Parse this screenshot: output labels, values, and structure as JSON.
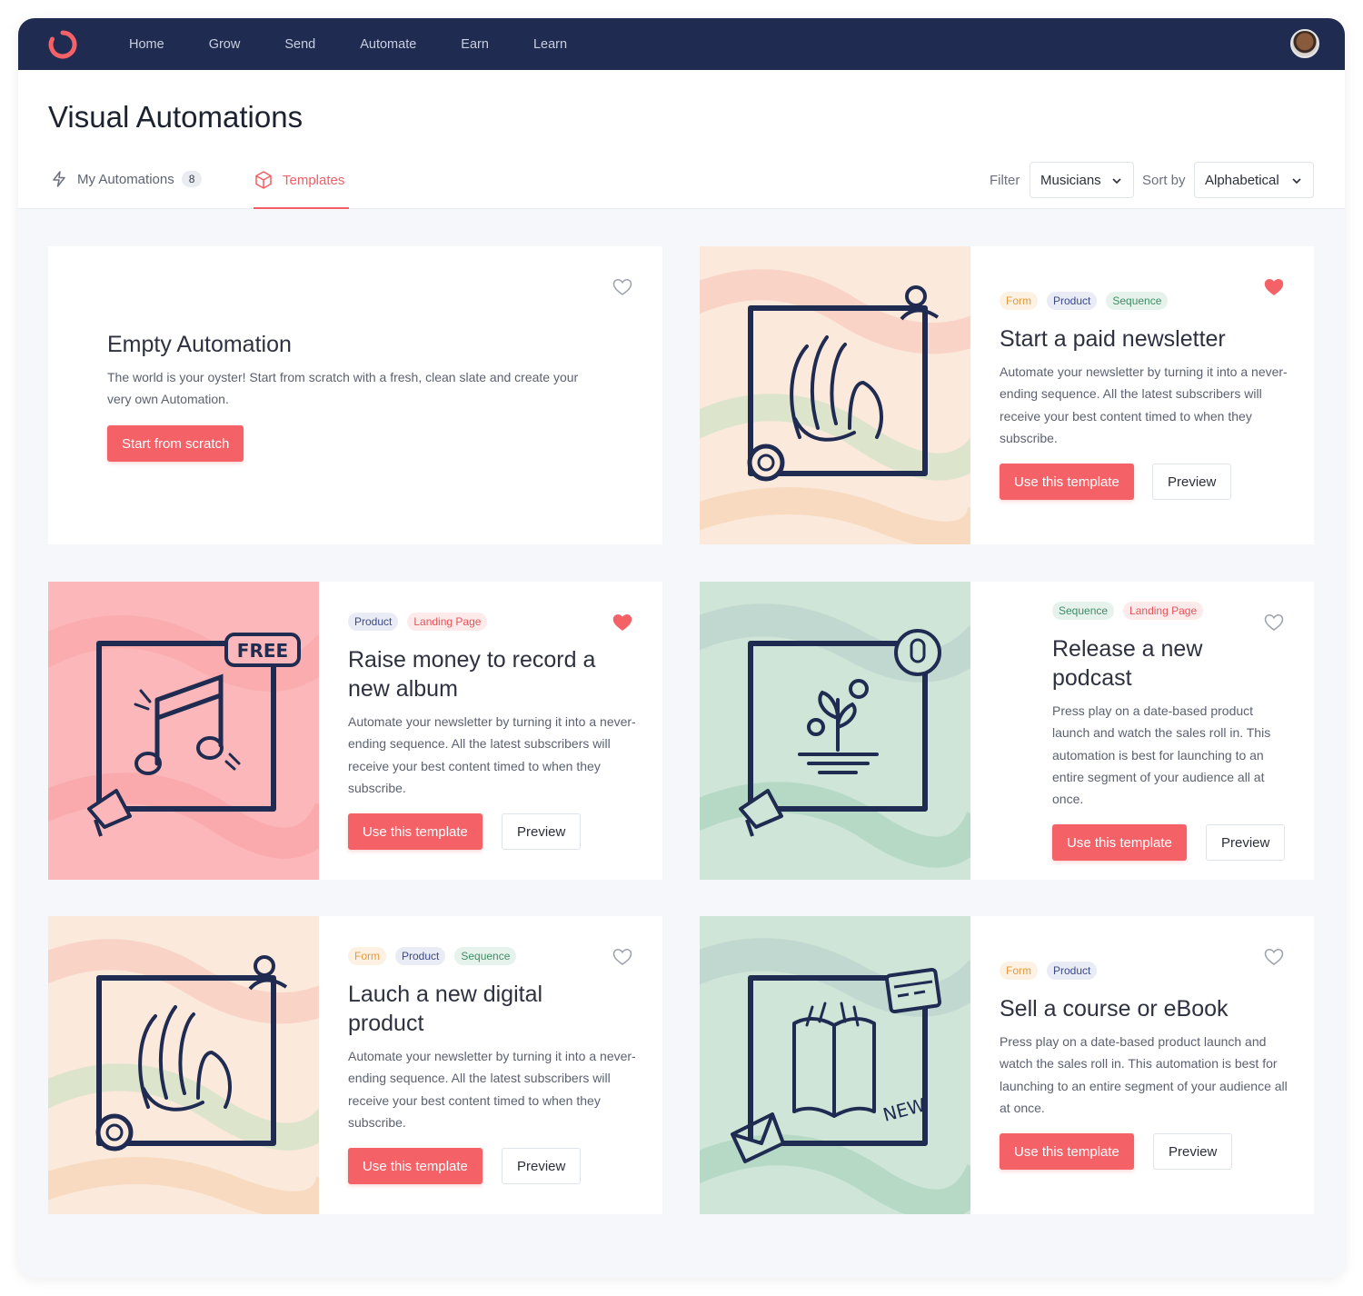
{
  "nav": {
    "items": [
      "Home",
      "Grow",
      "Send",
      "Automate",
      "Earn",
      "Learn"
    ]
  },
  "page": {
    "title": "Visual Automations"
  },
  "tabs": {
    "my_automations": {
      "label": "My Automations",
      "count": "8"
    },
    "templates": {
      "label": "Templates"
    }
  },
  "toolbar": {
    "filter_label": "Filter",
    "filter_value": "Musicians",
    "sort_label": "Sort by",
    "sort_value": "Alphabetical"
  },
  "colors": {
    "nav_bg": "#1f2b50",
    "accent": "#f46268",
    "peach_bg": "#fbe9db",
    "pink_bg": "#fbb7b9",
    "mint_bg": "#cfe5d8"
  },
  "empty_card": {
    "title": "Empty Automation",
    "description": "The world is your oyster! Start from scratch with a fresh, clean slate and create your very own Automation.",
    "button": "Start from scratch",
    "favorite": false
  },
  "templates": [
    {
      "tags": [
        "Form",
        "Product",
        "Sequence"
      ],
      "title": "Start a paid newsletter",
      "description": "Automate your newsletter by turning it into a never-ending sequence. All the latest subscribers will receive your best content timed to when they subscribe.",
      "primary": "Use this template",
      "secondary": "Preview",
      "favorite": true,
      "illustration": "hand-icon"
    },
    {
      "tags": [
        "Product",
        "Landing Page"
      ],
      "title": "Raise money to record a new album",
      "description": "Automate your newsletter by turning it into a never-ending sequence. All the latest subscribers will receive your best content timed to when they subscribe.",
      "primary": "Use this template",
      "secondary": "Preview",
      "favorite": true,
      "illustration": "music-note-icon",
      "badge": "FREE"
    },
    {
      "tags": [
        "Sequence",
        "Landing Page"
      ],
      "title": "Release a new podcast",
      "description": "Press play on a date-based product launch and watch the sales roll in. This automation is best for launching to an entire segment of your audience all at once.",
      "primary": "Use this template",
      "secondary": "Preview",
      "favorite": false,
      "illustration": "plant-icon"
    },
    {
      "tags": [
        "Form",
        "Product",
        "Sequence"
      ],
      "title": "Lauch a new digital product",
      "description": "Automate your newsletter by turning it into a never-ending sequence. All the latest subscribers will receive your best content timed to when they subscribe.",
      "primary": "Use this template",
      "secondary": "Preview",
      "favorite": false,
      "illustration": "hand-icon"
    },
    {
      "tags": [
        "Form",
        "Product"
      ],
      "title": "Sell a course or eBook",
      "description": "Press play on a date-based product launch and watch the sales roll in. This automation is best for launching to an entire segment of your audience all at once.",
      "primary": "Use this template",
      "secondary": "Preview",
      "favorite": false,
      "illustration": "book-icon",
      "badge": "NEW"
    }
  ]
}
